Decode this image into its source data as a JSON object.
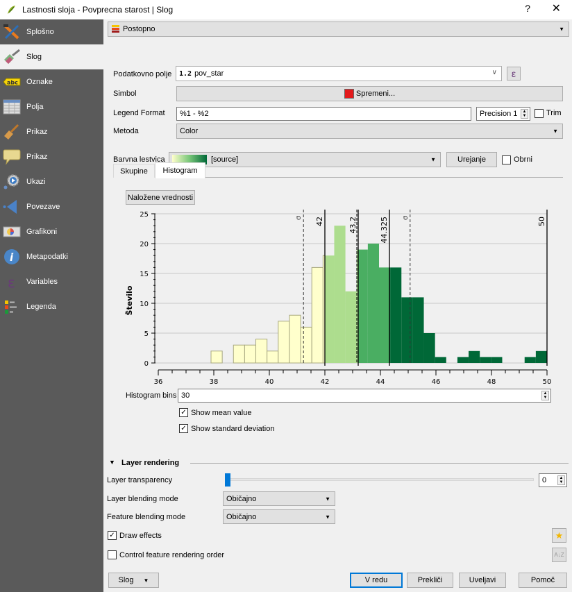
{
  "window": {
    "title": "Lastnosti sloja - Povprecna starost | Slog",
    "help_label": "?",
    "close_label": "✕"
  },
  "sidebar": {
    "items": [
      {
        "label": "Splošno",
        "icon": "tools-icon",
        "active": false
      },
      {
        "label": "Slog",
        "icon": "paintbrush-icon",
        "active": true
      },
      {
        "label": "Oznake",
        "icon": "abc-label-icon",
        "active": false
      },
      {
        "label": "Polja",
        "icon": "table-icon",
        "active": false
      },
      {
        "label": "Prikaz",
        "icon": "brush-icon",
        "active": false
      },
      {
        "label": "Prikaz",
        "icon": "speech-bubble-icon",
        "active": false
      },
      {
        "label": "Ukazi",
        "icon": "gear-play-icon",
        "active": false
      },
      {
        "label": "Povezave",
        "icon": "join-arrow-icon",
        "active": false
      },
      {
        "label": "Grafikoni",
        "icon": "diagram-icon",
        "active": false
      },
      {
        "label": "Metapodatki",
        "icon": "info-icon",
        "active": false
      },
      {
        "label": "Variables",
        "icon": "epsilon-icon",
        "active": false
      },
      {
        "label": "Legenda",
        "icon": "legend-icon",
        "active": false
      }
    ]
  },
  "renderer": {
    "type_label": "Postopno",
    "field_label": "Podatkovno polje",
    "field_type_badge": "1.2",
    "field_value": "pov_star",
    "expression_icon": "ε",
    "symbol_label": "Simbol",
    "symbol_button": "Spremeni...",
    "symbol_color": "#e31a1c",
    "legend_format_label": "Legend Format",
    "legend_format_value": "%1 - %2",
    "precision_value": "Precision 1",
    "trim_label": "Trim",
    "trim_checked": false,
    "method_label": "Metoda",
    "method_value": "Color",
    "color_ramp_label": "Barvna lestvica",
    "color_ramp_value": "[source]",
    "color_ramp_start": "#ffffcc",
    "color_ramp_end": "#006837",
    "edit_button": "Urejanje",
    "invert_label": "Obrni",
    "invert_checked": false
  },
  "tabs": [
    {
      "label": "Skupine",
      "active": false
    },
    {
      "label": "Histogram",
      "active": true
    }
  ],
  "histogram_panel": {
    "load_button": "Naložene vrednosti",
    "bins_label": "Histogram bins",
    "bins_value": "30",
    "show_mean_label": "Show mean value",
    "show_mean_checked": true,
    "show_std_label": "Show standard deviation",
    "show_std_checked": true
  },
  "chart_data": {
    "type": "bar",
    "title": "",
    "xlabel": "",
    "ylabel": "Število",
    "xlim": [
      36,
      50
    ],
    "ylim": [
      0,
      25
    ],
    "x_ticks": [
      36,
      38,
      40,
      42,
      44,
      46,
      48,
      50
    ],
    "y_ticks": [
      0,
      5,
      10,
      15,
      20,
      25
    ],
    "grid": true,
    "bin_start": 37.9,
    "bin_end": 50.0,
    "bin_count": 30,
    "values": [
      2,
      0,
      3,
      3,
      4,
      2,
      7,
      8,
      6,
      16,
      18,
      23,
      12,
      19,
      20,
      16,
      16,
      11,
      11,
      5,
      1,
      0,
      1,
      2,
      1,
      1,
      0,
      0,
      1,
      2
    ],
    "class_breaks": [
      {
        "value": 42,
        "label": "42"
      },
      {
        "value": 43.2,
        "label": "43.2"
      },
      {
        "value": 44.325,
        "label": "44.325"
      },
      {
        "value": 50,
        "label": "50"
      }
    ],
    "class_colors": [
      "#ffffcc",
      "#addd8e",
      "#4aae62",
      "#006837"
    ],
    "mean": 43.15,
    "std_lines": [
      {
        "value": 41.23,
        "label": "σ"
      },
      {
        "value": 45.07,
        "label": "σ"
      }
    ]
  },
  "layer_rendering": {
    "section_title": "Layer rendering",
    "transparency_label": "Layer transparency",
    "transparency_value": "0",
    "transparency_fraction": 0,
    "layer_blend_label": "Layer blending mode",
    "layer_blend_value": "Običajno",
    "feature_blend_label": "Feature blending mode",
    "feature_blend_value": "Običajno",
    "draw_effects_label": "Draw effects",
    "draw_effects_checked": true,
    "control_order_label": "Control feature rendering order",
    "control_order_checked": false
  },
  "footer": {
    "style_button": "Slog",
    "ok_button": "V redu",
    "cancel_button": "Prekliči",
    "apply_button": "Uveljavi",
    "help_button": "Pomoč"
  }
}
